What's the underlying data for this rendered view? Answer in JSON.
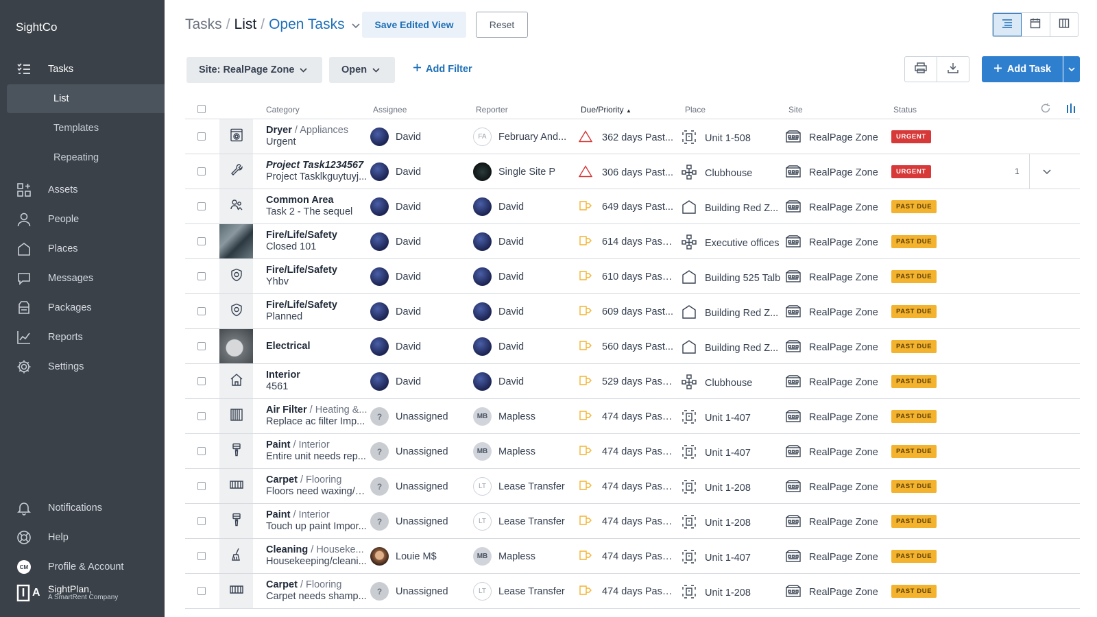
{
  "app": {
    "name": "SightCo"
  },
  "sidebar": {
    "tasks_label": "Tasks",
    "sub_items": [
      {
        "label": "List",
        "active": true
      },
      {
        "label": "Templates"
      },
      {
        "label": "Repeating"
      }
    ],
    "items": [
      {
        "label": "Assets",
        "icon": "grid-plus-icon"
      },
      {
        "label": "People",
        "icon": "person-icon"
      },
      {
        "label": "Places",
        "icon": "house-icon"
      },
      {
        "label": "Messages",
        "icon": "chat-bubble-icon"
      },
      {
        "label": "Packages",
        "icon": "package-icon"
      },
      {
        "label": "Reports",
        "icon": "line-chart-icon"
      },
      {
        "label": "Settings",
        "icon": "gear-icon"
      }
    ],
    "bottom_items": [
      {
        "label": "Notifications",
        "icon": "bell-icon"
      },
      {
        "label": "Help",
        "icon": "lifebuoy-icon"
      },
      {
        "label": "Profile & Account",
        "icon": "avatar-icon",
        "initials": "CM"
      }
    ],
    "company": {
      "line1": "SightPlan,",
      "line2": "A SmartRent Company",
      "logo_letter": "A"
    }
  },
  "header": {
    "breadcrumb": [
      "Tasks",
      "List",
      "Open Tasks"
    ],
    "separator": "/",
    "save_label": "Save Edited View",
    "reset_label": "Reset"
  },
  "filters": {
    "site": "Site: RealPage Zone",
    "status": "Open",
    "add_filter": "Add Filter"
  },
  "actions": {
    "add_task": "Add Task"
  },
  "table": {
    "columns": {
      "category": "Category",
      "assignee": "Assignee",
      "reporter": "Reporter",
      "due": "Due/Priority",
      "place": "Place",
      "site": "Site",
      "status": "Status"
    },
    "rows": [
      {
        "cat": "Dryer",
        "sub": "Appliances",
        "desc": "Urgent",
        "assignee": "David",
        "a_type": "david",
        "reporter": "February And...",
        "r_type": "init",
        "r_init": "FA",
        "due": "362 days Past...",
        "due_type": "warn",
        "place": "Unit 1-508",
        "place_type": "unit",
        "site": "RealPage Zone",
        "status": "URGENT",
        "status_type": "urgent",
        "icon": "dryer-icon",
        "thumb": "icon"
      },
      {
        "cat": "Project Task1234567",
        "sub": "",
        "desc": "Project Tasklkguytuyj...",
        "italic": true,
        "assignee": "David",
        "a_type": "david",
        "reporter": "Single Site P",
        "r_type": "ss",
        "due": "306 days Past...",
        "due_type": "warn",
        "place": "Clubhouse",
        "place_type": "org",
        "site": "RealPage Zone",
        "status": "URGENT",
        "status_type": "urgent",
        "icon": "wrench-icon",
        "thumb": "icon",
        "count": "1"
      },
      {
        "cat": "Common Area",
        "sub": "",
        "desc": "Task 2 - The sequel",
        "assignee": "David",
        "a_type": "david",
        "reporter": "David",
        "r_type": "david",
        "due": "649 days Past...",
        "due_type": "flag",
        "place": "Building Red Z...",
        "place_type": "bldg",
        "site": "RealPage Zone",
        "status": "PAST DUE",
        "status_type": "pastdue",
        "icon": "people-icon",
        "thumb": "icon"
      },
      {
        "cat": "Fire/Life/Safety",
        "sub": "",
        "desc": "Closed 101",
        "assignee": "David",
        "a_type": "david",
        "reporter": "David",
        "r_type": "david",
        "due": "614 days Past ...",
        "due_type": "flag",
        "place": "Executive offices",
        "place_type": "org",
        "site": "RealPage Zone",
        "status": "PAST DUE",
        "status_type": "pastdue",
        "icon": "photo-icon",
        "thumb": "photo1"
      },
      {
        "cat": "Fire/Life/Safety",
        "sub": "",
        "desc": "Yhbv",
        "assignee": "David",
        "a_type": "david",
        "reporter": "David",
        "r_type": "david",
        "due": "610 days Past ...",
        "due_type": "flag",
        "place": "Building 525 Talb",
        "place_type": "bldg",
        "site": "RealPage Zone",
        "status": "PAST DUE",
        "status_type": "pastdue",
        "icon": "shield-icon",
        "thumb": "icon"
      },
      {
        "cat": "Fire/Life/Safety",
        "sub": "",
        "desc": "Planned",
        "assignee": "David",
        "a_type": "david",
        "reporter": "David",
        "r_type": "david",
        "due": "609 days Past...",
        "due_type": "flag",
        "place": "Building Red Z...",
        "place_type": "bldg",
        "site": "RealPage Zone",
        "status": "PAST DUE",
        "status_type": "pastdue",
        "icon": "shield-icon",
        "thumb": "icon"
      },
      {
        "cat": "Electrical",
        "sub": "",
        "desc": "",
        "assignee": "David",
        "a_type": "david",
        "reporter": "David",
        "r_type": "david",
        "due": "560 days Past...",
        "due_type": "flag",
        "place": "Building Red Z...",
        "place_type": "bldg",
        "site": "RealPage Zone",
        "status": "PAST DUE",
        "status_type": "pastdue",
        "icon": "photo-icon",
        "thumb": "photo2"
      },
      {
        "cat": "Interior",
        "sub": "",
        "desc": "4561",
        "assignee": "David",
        "a_type": "david",
        "reporter": "David",
        "r_type": "david",
        "due": "529 days Past ...",
        "due_type": "flag",
        "place": "Clubhouse",
        "place_type": "org",
        "site": "RealPage Zone",
        "status": "PAST DUE",
        "status_type": "pastdue",
        "icon": "home-icon",
        "thumb": "icon"
      },
      {
        "cat": "Air Filter",
        "sub": "Heating &...",
        "desc": "Replace ac filter Imp...",
        "assignee": "Unassigned",
        "a_type": "un",
        "reporter": "Mapless",
        "r_type": "mb",
        "r_init": "MB",
        "due": "474 days Past ...",
        "due_type": "flag",
        "place": "Unit 1-407",
        "place_type": "unit",
        "site": "RealPage Zone",
        "status": "PAST DUE",
        "status_type": "pastdue",
        "icon": "filter-icon",
        "thumb": "icon"
      },
      {
        "cat": "Paint",
        "sub": "Interior",
        "desc": "Entire unit needs rep...",
        "assignee": "Unassigned",
        "a_type": "un",
        "reporter": "Mapless",
        "r_type": "mb",
        "r_init": "MB",
        "due": "474 days Past ...",
        "due_type": "flag",
        "place": "Unit 1-407",
        "place_type": "unit",
        "site": "RealPage Zone",
        "status": "PAST DUE",
        "status_type": "pastdue",
        "icon": "paintbrush-icon",
        "thumb": "icon"
      },
      {
        "cat": "Carpet",
        "sub": "Flooring",
        "desc": "Floors need waxing/p...",
        "assignee": "Unassigned",
        "a_type": "un",
        "reporter": "Lease Transfer",
        "r_type": "init",
        "r_init": "LT",
        "due": "474 days Past ...",
        "due_type": "flag",
        "place": "Unit 1-208",
        "place_type": "unit",
        "site": "RealPage Zone",
        "status": "PAST DUE",
        "status_type": "pastdue",
        "icon": "carpet-icon",
        "thumb": "icon"
      },
      {
        "cat": "Paint",
        "sub": "Interior",
        "desc": "Touch up paint Impor...",
        "assignee": "Unassigned",
        "a_type": "un",
        "reporter": "Lease Transfer",
        "r_type": "init",
        "r_init": "LT",
        "due": "474 days Past ...",
        "due_type": "flag",
        "place": "Unit 1-208",
        "place_type": "unit",
        "site": "RealPage Zone",
        "status": "PAST DUE",
        "status_type": "pastdue",
        "icon": "paintbrush-icon",
        "thumb": "icon"
      },
      {
        "cat": "Cleaning",
        "sub": "Houseke...",
        "desc": "Housekeeping/cleani...",
        "assignee": "Louie M$",
        "a_type": "louie",
        "reporter": "Mapless",
        "r_type": "mb",
        "r_init": "MB",
        "due": "474 days Past ...",
        "due_type": "flag",
        "place": "Unit 1-407",
        "place_type": "unit",
        "site": "RealPage Zone",
        "status": "PAST DUE",
        "status_type": "pastdue",
        "icon": "broom-icon",
        "thumb": "icon"
      },
      {
        "cat": "Carpet",
        "sub": "Flooring",
        "desc": "Carpet needs shamp...",
        "assignee": "Unassigned",
        "a_type": "un",
        "reporter": "Lease Transfer",
        "r_type": "init",
        "r_init": "LT",
        "due": "474 days Past ...",
        "due_type": "flag",
        "place": "Unit 1-208",
        "place_type": "unit",
        "site": "RealPage Zone",
        "status": "PAST DUE",
        "status_type": "pastdue",
        "icon": "carpet-icon",
        "thumb": "icon"
      }
    ]
  },
  "colors": {
    "sidebar": "#3a4149",
    "accent": "#1d6fb8",
    "urgent": "#d73838",
    "past_due": "#f4b32f"
  }
}
